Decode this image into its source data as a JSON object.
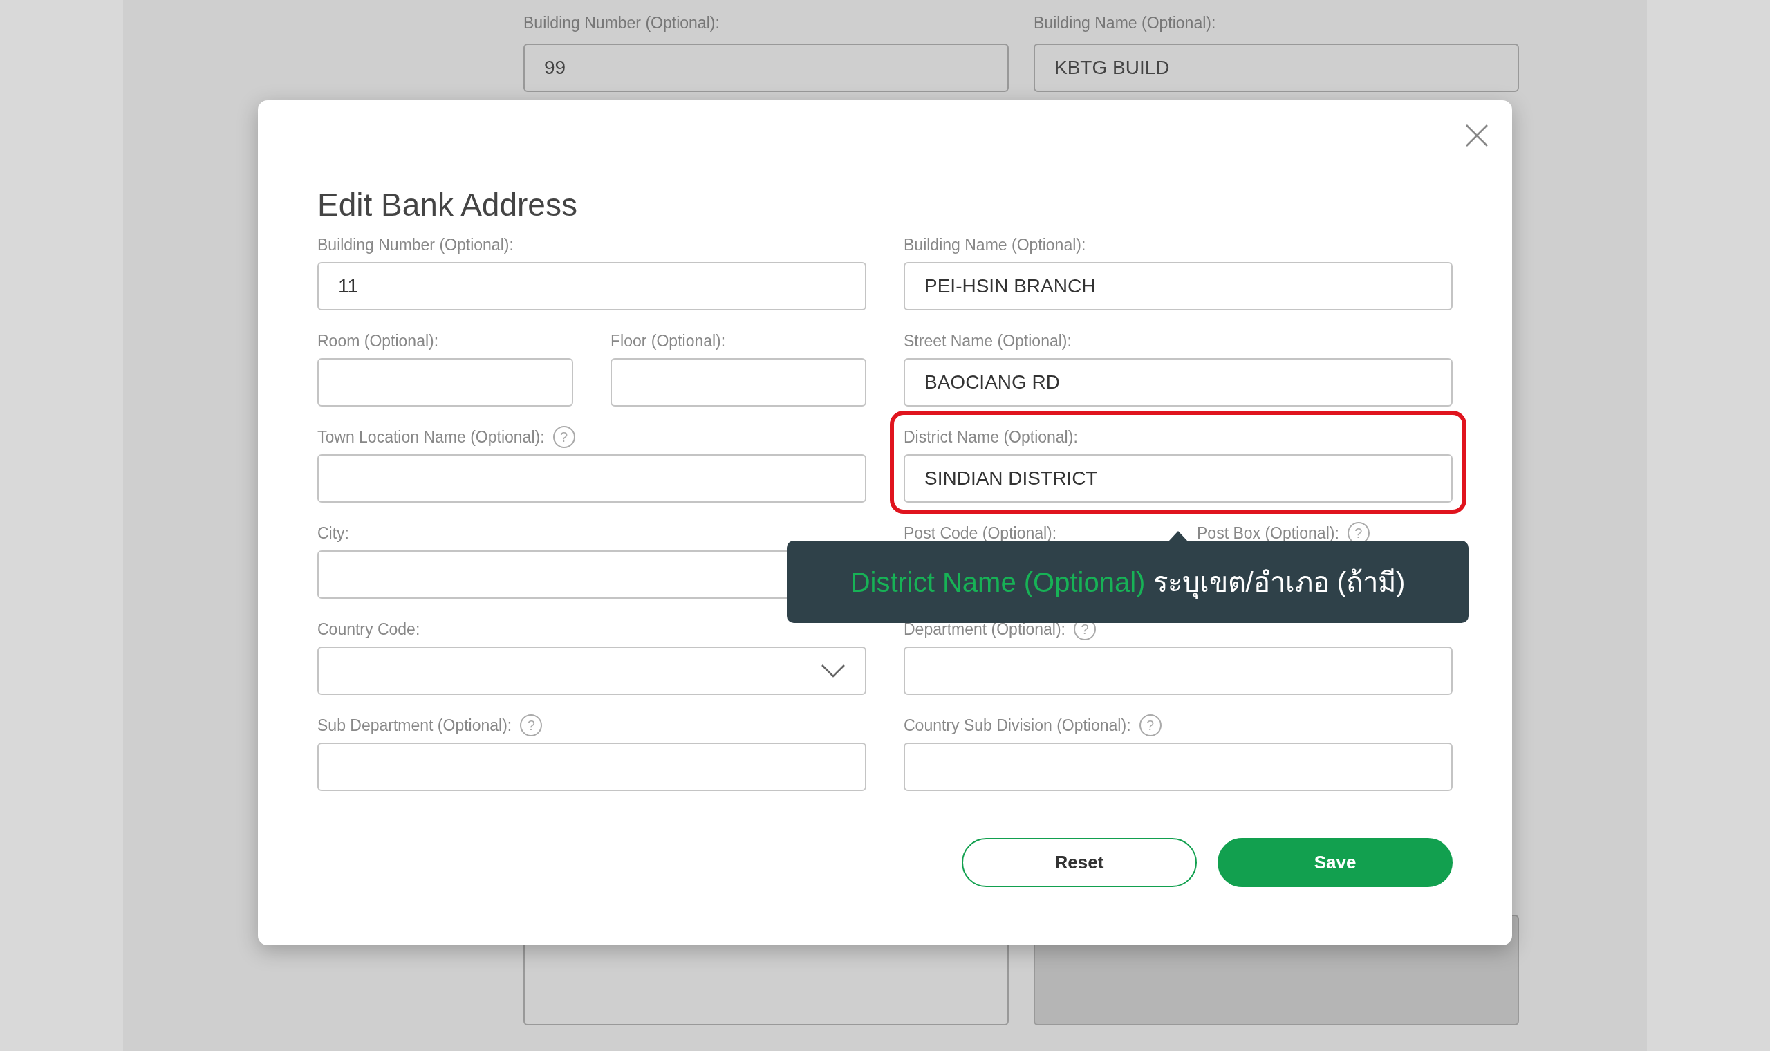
{
  "background_form": {
    "fields": [
      {
        "label": "Building Number (Optional):",
        "value": "99"
      },
      {
        "label": "Building Name (Optional):",
        "value": "KBTG BUILD"
      }
    ],
    "lower_fields": [
      {
        "disabled": false
      },
      {
        "disabled": true
      }
    ]
  },
  "dialog": {
    "title": "Edit Bank Address",
    "rows": [
      {
        "columns": [
          [
            {
              "kind": "text",
              "label": "Building Number (Optional):",
              "value": "11"
            }
          ],
          [
            {
              "kind": "text",
              "label": "Building Name (Optional):",
              "value": "PEI-HSIN BRANCH"
            }
          ]
        ]
      },
      {
        "columns": [
          [
            {
              "kind": "text",
              "label": "Room (Optional):"
            },
            {
              "kind": "text",
              "label": "Floor (Optional):"
            }
          ],
          [
            {
              "kind": "text",
              "label": "Street Name (Optional):",
              "value": "BAOCIANG RD"
            }
          ]
        ]
      },
      {
        "columns": [
          [
            {
              "kind": "text",
              "label": "Town Location Name (Optional):",
              "help": "?"
            }
          ],
          [
            {
              "kind": "text",
              "label": "District Name (Optional):",
              "value": "SINDIAN DISTRICT",
              "highlighted": true
            }
          ]
        ]
      },
      {
        "columns": [
          [
            {
              "kind": "text",
              "label": "City:"
            }
          ],
          [
            {
              "kind": "text",
              "label": "Post Code (Optional):"
            },
            {
              "kind": "text",
              "label": "Post Box (Optional):",
              "help": "?"
            }
          ]
        ]
      },
      {
        "columns": [
          [
            {
              "kind": "select",
              "label": "Country Code:"
            }
          ],
          [
            {
              "kind": "text",
              "label": "Department (Optional):",
              "help": "?"
            }
          ]
        ]
      },
      {
        "columns": [
          [
            {
              "kind": "text",
              "label": "Sub Department (Optional):",
              "help": "?"
            }
          ],
          [
            {
              "kind": "text",
              "label": "Country Sub Division (Optional):",
              "help": "?"
            }
          ]
        ]
      }
    ],
    "tooltip": {
      "term": "District Name (Optional)",
      "text": "ระบุเขต/อำเภอ (ถ้ามี)"
    },
    "buttons": [
      {
        "kind": "outline",
        "label": "Reset"
      },
      {
        "kind": "primary",
        "label": "Save"
      }
    ]
  }
}
